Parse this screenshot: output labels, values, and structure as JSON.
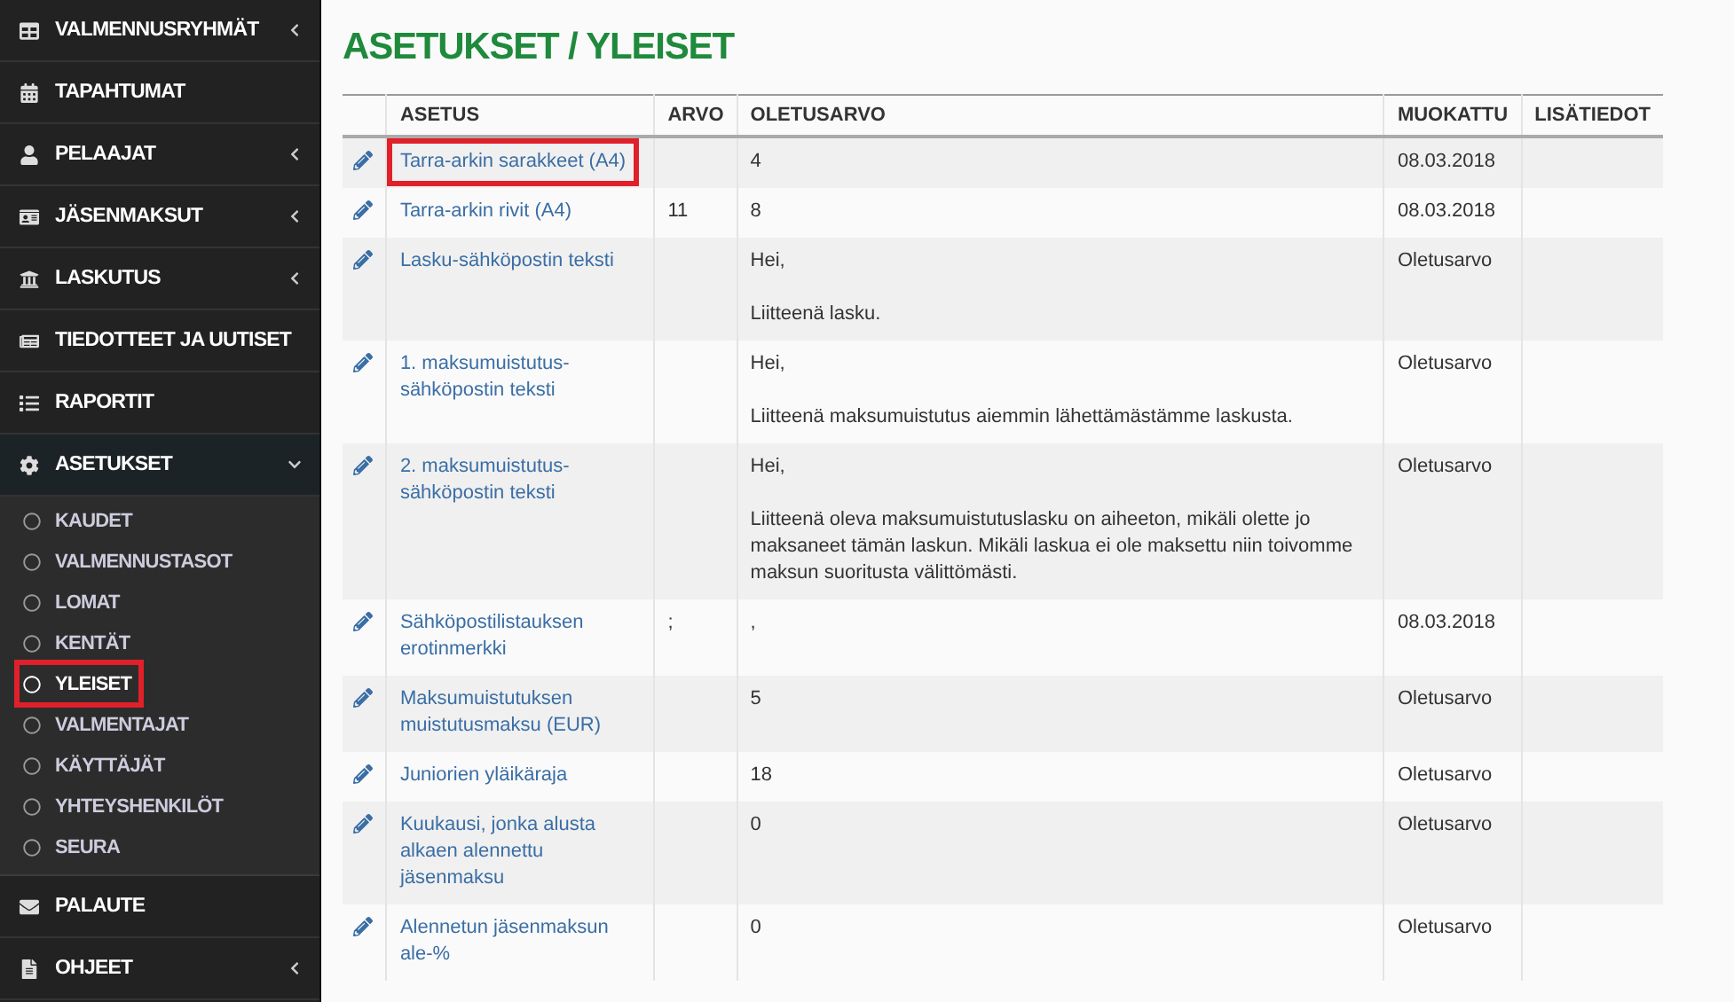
{
  "sidebar": {
    "items": [
      {
        "label": "VALMENNUSRYHMÄT",
        "expandable": true,
        "expanded": false
      },
      {
        "label": "TAPAHTUMAT",
        "expandable": false
      },
      {
        "label": "PELAAJAT",
        "expandable": true,
        "expanded": false
      },
      {
        "label": "JÄSENMAKSUT",
        "expandable": true,
        "expanded": false
      },
      {
        "label": "LASKUTUS",
        "expandable": true,
        "expanded": false
      },
      {
        "label": "TIEDOTTEET JA UUTISET",
        "expandable": false
      },
      {
        "label": "RAPORTIT",
        "expandable": false
      },
      {
        "label": "ASETUKSET",
        "expandable": true,
        "expanded": true,
        "children": [
          {
            "label": "KAUDET",
            "selected": false,
            "highlighted": false
          },
          {
            "label": "VALMENNUSTASOT",
            "selected": false,
            "highlighted": false
          },
          {
            "label": "LOMAT",
            "selected": false,
            "highlighted": false
          },
          {
            "label": "KENTÄT",
            "selected": false,
            "highlighted": false
          },
          {
            "label": "YLEISET",
            "selected": true,
            "highlighted": true
          },
          {
            "label": "VALMENTAJAT",
            "selected": false,
            "highlighted": false
          },
          {
            "label": "KÄYTTÄJÄT",
            "selected": false,
            "highlighted": false
          },
          {
            "label": "YHTEYSHENKILÖT",
            "selected": false,
            "highlighted": false
          },
          {
            "label": "SEURA",
            "selected": false,
            "highlighted": false
          }
        ]
      },
      {
        "label": "PALAUTE",
        "expandable": false
      },
      {
        "label": "OHJEET",
        "expandable": true,
        "expanded": false
      }
    ]
  },
  "page_title": "ASETUKSET / YLEISET",
  "table": {
    "columns": [
      "ASETUS",
      "ARVO",
      "OLETUSARVO",
      "MUOKATTU",
      "LISÄTIEDOT"
    ],
    "rows": [
      {
        "name": "Tarra-arkin sarakkeet (A4)",
        "highlighted": true,
        "default": [
          "4"
        ],
        "modified": "08.03.2018"
      },
      {
        "name": "Tarra-arkin rivit (A4)",
        "highlighted": false,
        "value": "11",
        "default": [
          "8"
        ],
        "modified": "08.03.2018"
      },
      {
        "name": "Lasku-sähköpostin teksti",
        "highlighted": false,
        "default": [
          "Hei,",
          "Liitteenä lasku."
        ],
        "modified": "Oletusarvo"
      },
      {
        "name": "1. maksumuistutus-sähköpostin teksti",
        "highlighted": false,
        "default": [
          "Hei,",
          "Liitteenä maksumuistutus aiemmin lähettämästämme laskusta."
        ],
        "modified": "Oletusarvo"
      },
      {
        "name": "2. maksumuistutus-sähköpostin teksti",
        "highlighted": false,
        "default": [
          "Hei,",
          "Liitteenä oleva maksumuistutuslasku on aiheeton, mikäli olette jo maksaneet tämän laskun. Mikäli laskua ei ole maksettu niin toivomme maksun suoritusta välittömästi."
        ],
        "modified": "Oletusarvo"
      },
      {
        "name": "Sähköpostilistauksen erotinmerkki",
        "highlighted": false,
        "value": ";",
        "default": [
          ","
        ],
        "modified": "08.03.2018"
      },
      {
        "name": "Maksumuistutuksen muistutusmaksu (EUR)",
        "highlighted": false,
        "default": [
          "5"
        ],
        "modified": "Oletusarvo"
      },
      {
        "name": "Juniorien yläikäraja",
        "highlighted": false,
        "default": [
          "18"
        ],
        "modified": "Oletusarvo"
      },
      {
        "name": "Kuukausi, jonka alusta alkaen alennettu jäsenmaksu",
        "highlighted": false,
        "default": [
          "0"
        ],
        "modified": "Oletusarvo"
      },
      {
        "name": "Alennetun jäsenmaksun ale-%",
        "highlighted": false,
        "default": [
          "0"
        ],
        "modified": "Oletusarvo"
      }
    ]
  }
}
